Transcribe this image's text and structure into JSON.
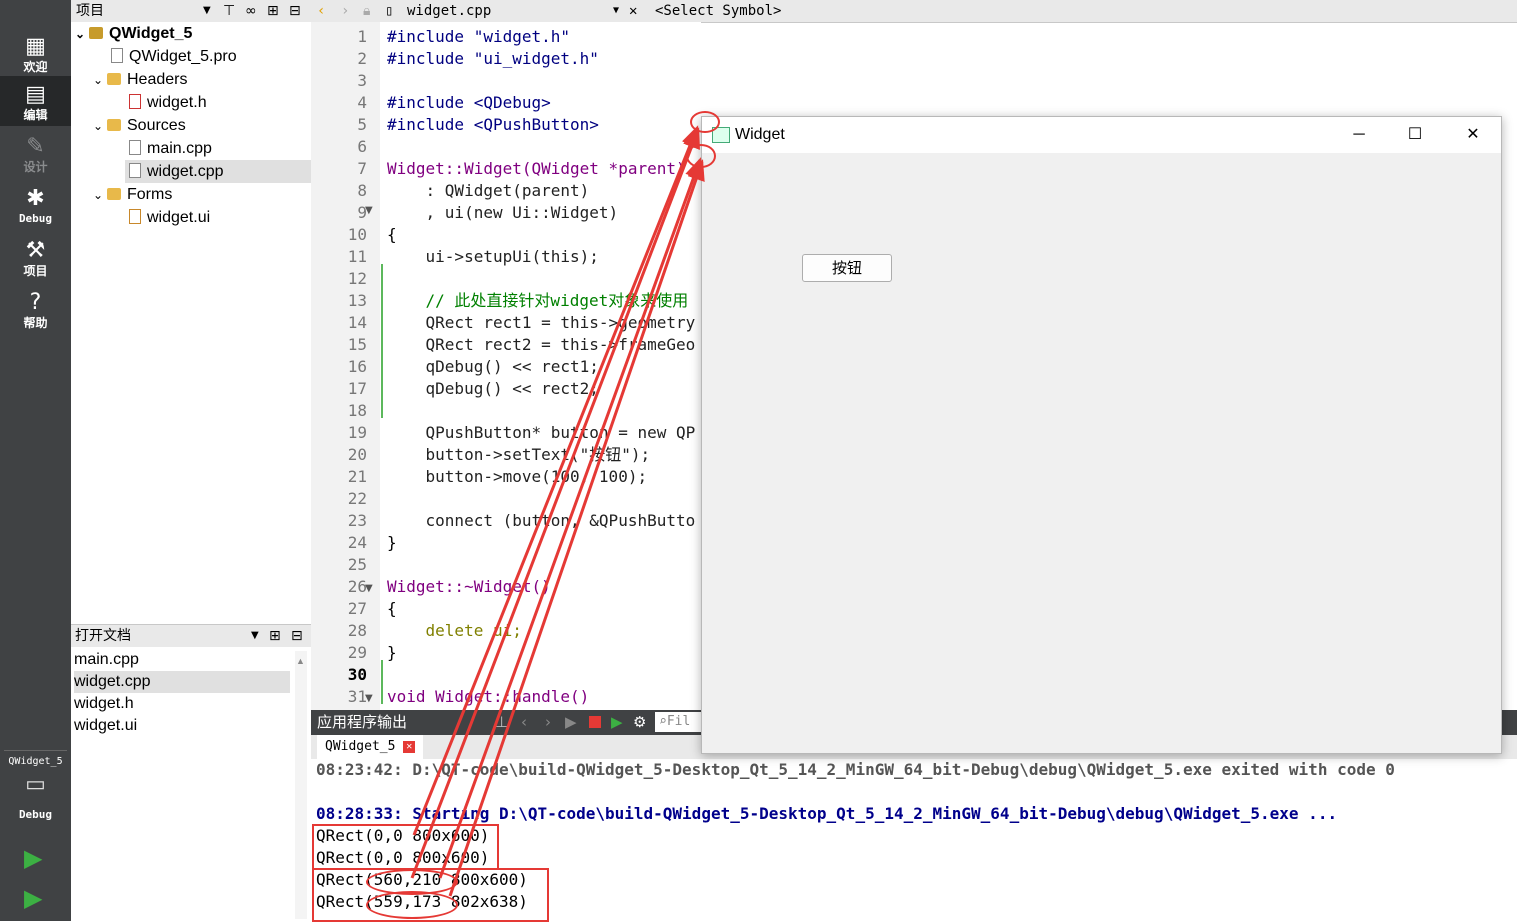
{
  "modebar": {
    "items": [
      {
        "label": "欢迎",
        "icon": "grid-icon"
      },
      {
        "label": "编辑",
        "icon": "edit-icon"
      },
      {
        "label": "设计",
        "icon": "pen-icon"
      },
      {
        "label": "Debug",
        "icon": "bug-icon"
      },
      {
        "label": "项目",
        "icon": "wrench-icon"
      },
      {
        "label": "帮助",
        "icon": "help-icon"
      }
    ],
    "kit_name": "QWidget_5",
    "kit_mode": "Debug"
  },
  "project_pane": {
    "title": "项目",
    "tree": [
      {
        "label": "QWidget_5",
        "level": 0,
        "kind": "project"
      },
      {
        "label": "QWidget_5.pro",
        "level": 1,
        "kind": "file"
      },
      {
        "label": "Headers",
        "level": 1,
        "kind": "folder"
      },
      {
        "label": "widget.h",
        "level": 2,
        "kind": "file"
      },
      {
        "label": "Sources",
        "level": 1,
        "kind": "folder"
      },
      {
        "label": "main.cpp",
        "level": 2,
        "kind": "file"
      },
      {
        "label": "widget.cpp",
        "level": 2,
        "kind": "file",
        "selected": true
      },
      {
        "label": "Forms",
        "level": 1,
        "kind": "folder"
      },
      {
        "label": "widget.ui",
        "level": 2,
        "kind": "file"
      }
    ]
  },
  "open_docs": {
    "title": "打开文档",
    "items": [
      "main.cpp",
      "widget.cpp",
      "widget.h",
      "widget.ui"
    ],
    "selected": "widget.cpp"
  },
  "editor": {
    "filename": "widget.cpp",
    "symbol": "<Select Symbol>",
    "current_line": "30",
    "lines": [
      {
        "n": "1",
        "t": "#include \"widget.h\""
      },
      {
        "n": "2",
        "t": "#include \"ui_widget.h\""
      },
      {
        "n": "3",
        "t": ""
      },
      {
        "n": "4",
        "t": "#include <QDebug>"
      },
      {
        "n": "5",
        "t": "#include <QPushButton>"
      },
      {
        "n": "6",
        "t": ""
      },
      {
        "n": "7",
        "t": "Widget::Widget(QWidget *parent)"
      },
      {
        "n": "8",
        "t": "    : QWidget(parent)"
      },
      {
        "n": "9",
        "t": "    , ui(new Ui::Widget)"
      },
      {
        "n": "10",
        "t": "{"
      },
      {
        "n": "11",
        "t": "    ui->setupUi(this);"
      },
      {
        "n": "12",
        "t": ""
      },
      {
        "n": "13",
        "t": "    // 此处直接针对widget对象来使用"
      },
      {
        "n": "14",
        "t": "    QRect rect1 = this->geometry"
      },
      {
        "n": "15",
        "t": "    QRect rect2 = this->frameGeo"
      },
      {
        "n": "16",
        "t": "    qDebug() << rect1;"
      },
      {
        "n": "17",
        "t": "    qDebug() << rect2;"
      },
      {
        "n": "18",
        "t": ""
      },
      {
        "n": "19",
        "t": "    QPushButton* button = new QP"
      },
      {
        "n": "20",
        "t": "    button->setText(\"按钮\");"
      },
      {
        "n": "21",
        "t": "    button->move(100, 100);"
      },
      {
        "n": "22",
        "t": ""
      },
      {
        "n": "23",
        "t": "    connect (button, &QPushButto"
      },
      {
        "n": "24",
        "t": "}"
      },
      {
        "n": "25",
        "t": ""
      },
      {
        "n": "26",
        "t": "Widget::~Widget()"
      },
      {
        "n": "27",
        "t": "{"
      },
      {
        "n": "28",
        "t": "    delete ui;"
      },
      {
        "n": "29",
        "t": "}"
      },
      {
        "n": "30",
        "t": ""
      },
      {
        "n": "31",
        "t": "void Widget::handle()"
      }
    ]
  },
  "output": {
    "title": "应用程序输出",
    "tab": "QWidget_5",
    "filter_placeholder": "Fil",
    "lines": [
      {
        "text": "08:23:42: D:\\QT-code\\build-QWidget_5-Desktop_Qt_5_14_2_MinGW_64_bit-Debug\\debug\\QWidget_5.exe exited with code 0",
        "style": "b"
      },
      {
        "text": "",
        "style": ""
      },
      {
        "text": "08:28:33: Starting D:\\QT-code\\build-QWidget_5-Desktop_Qt_5_14_2_MinGW_64_bit-Debug\\debug\\QWidget_5.exe ...",
        "style": "blue"
      },
      {
        "text": "QRect(0,0 800x600)",
        "style": ""
      },
      {
        "text": "QRect(0,0 800x600)",
        "style": ""
      },
      {
        "text": "QRect(560,210 800x600)",
        "style": ""
      },
      {
        "text": "QRect(559,173 802x638)",
        "style": ""
      }
    ]
  },
  "widget_window": {
    "title": "Widget",
    "button_label": "按钮",
    "controls": {
      "minimize": "─",
      "maximize": "☐",
      "close": "✕"
    }
  },
  "colors": {
    "annotation": "#e53935",
    "modebar": "#404244",
    "accent_green": "#3cb043"
  }
}
